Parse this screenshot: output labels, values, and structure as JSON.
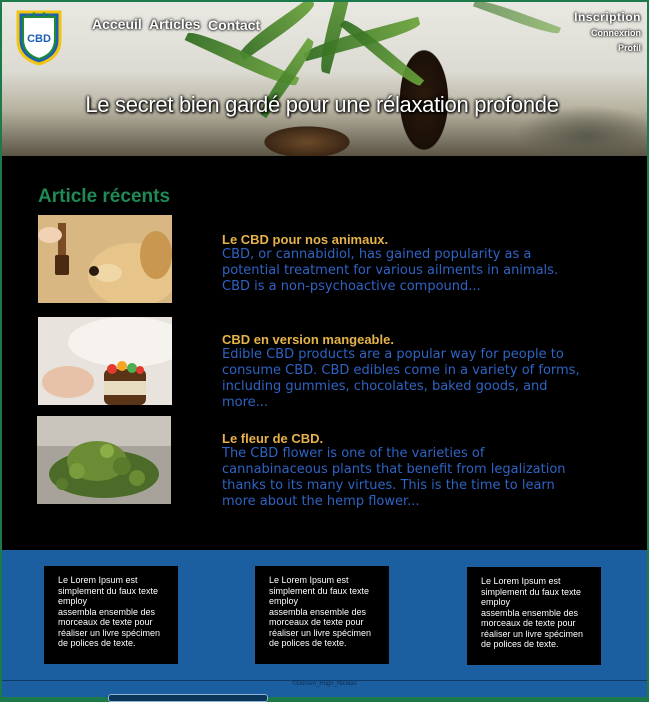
{
  "header": {
    "logo_text": "CBD",
    "nav": [
      "Acceuil",
      "Articles",
      "Contact"
    ],
    "hero_title": "Le secret bien gardé pour une rélaxation profonde",
    "auth": {
      "inscription": "Inscription",
      "connexion": "Connexrion",
      "profil": "Profil"
    }
  },
  "main": {
    "section_title": "Article récents",
    "articles": [
      {
        "title": "Le CBD pour nos animaux.",
        "text": "CBD, or cannabidiol, has gained popularity as a potential treatment for various ailments in animals. CBD is a non-psychoactive compound..."
      },
      {
        "title": "CBD en version mangeable.",
        "text": "Edible CBD products are a popular way for people to consume CBD. CBD edibles come in a variety of forms, including gummies, chocolates, baked goods, and more..."
      },
      {
        "title": "Le fleur de CBD.",
        "text": "The CBD flower is one of the varieties of cannabinaceous plants that benefit from legalization thanks to its many virtues. This is the time to learn more about the hemp flower..."
      }
    ]
  },
  "footer": {
    "cards": [
      {
        "line1": "Le Lorem Ipsum est simplement du faux texte employ",
        "line2": " assembla ensemble des morceaux de texte pour réaliser un livre spécimen de polices de texte."
      },
      {
        "line1": "Le Lorem Ipsum est simplement du faux texte employ",
        "line2": " assembla ensemble des morceaux de texte pour réaliser un livre spécimen de polices de texte."
      },
      {
        "line1": "Le Lorem Ipsum est simplement du faux texte employ",
        "line2": " assembla ensemble des morceaux de texte pour réaliser un livre spécimen de polices de texte."
      }
    ],
    "copyright": "©Dorsen_Hugo_Nicolas"
  },
  "colors": {
    "frame": "#1c7a4a",
    "section_title": "#1f8a55",
    "article_title": "#e6b24a",
    "article_text": "#2f63c4",
    "footer_bg": "#1c5fa0"
  }
}
